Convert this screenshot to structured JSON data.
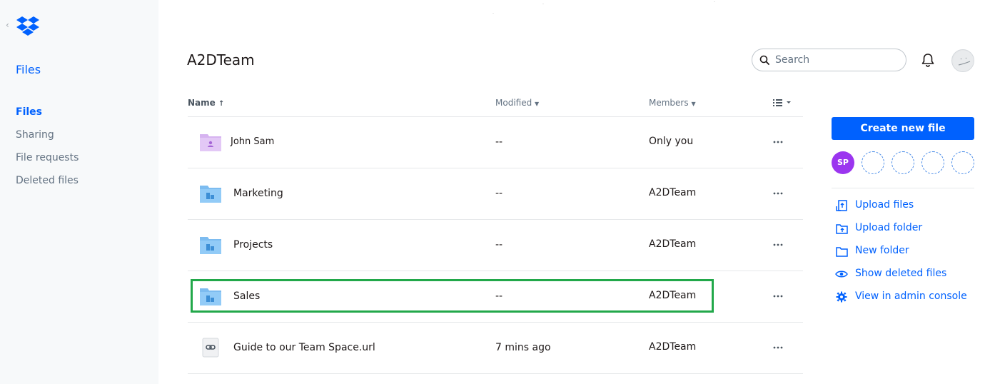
{
  "sidebar": {
    "title": "Files",
    "items": [
      {
        "label": "Files",
        "active": true
      },
      {
        "label": "Sharing"
      },
      {
        "label": "File requests"
      },
      {
        "label": "Deleted files"
      }
    ]
  },
  "header": {
    "title": "A2DTeam",
    "search_placeholder": "Search"
  },
  "table": {
    "columns": {
      "name": "Name",
      "modified": "Modified",
      "members": "Members"
    },
    "rows": [
      {
        "name": "John Sam",
        "modified": "--",
        "members": "Only you",
        "type": "private-folder"
      },
      {
        "name": "Marketing",
        "modified": "--",
        "members": "A2DTeam",
        "type": "team-folder"
      },
      {
        "name": "Projects",
        "modified": "--",
        "members": "A2DTeam",
        "type": "team-folder"
      },
      {
        "name": "Sales",
        "modified": "--",
        "members": "A2DTeam",
        "type": "team-folder",
        "highlighted": true
      },
      {
        "name": "Guide to our Team Space.url",
        "modified": "7 mins ago",
        "members": "A2DTeam",
        "type": "link-file"
      }
    ]
  },
  "right_panel": {
    "create_button": "Create new file",
    "member_initials": "SP",
    "actions": [
      {
        "label": "Upload files",
        "icon": "upload-file-icon"
      },
      {
        "label": "Upload folder",
        "icon": "upload-folder-icon"
      },
      {
        "label": "New folder",
        "icon": "new-folder-icon"
      },
      {
        "label": "Show deleted files",
        "icon": "eye-icon"
      },
      {
        "label": "View in admin console",
        "icon": "gear-icon"
      }
    ]
  },
  "colors": {
    "accent": "#0061fe",
    "highlight": "#22a84a",
    "member_avatar": "#9b35ef",
    "sidebar_bg": "#f7f9fa"
  }
}
